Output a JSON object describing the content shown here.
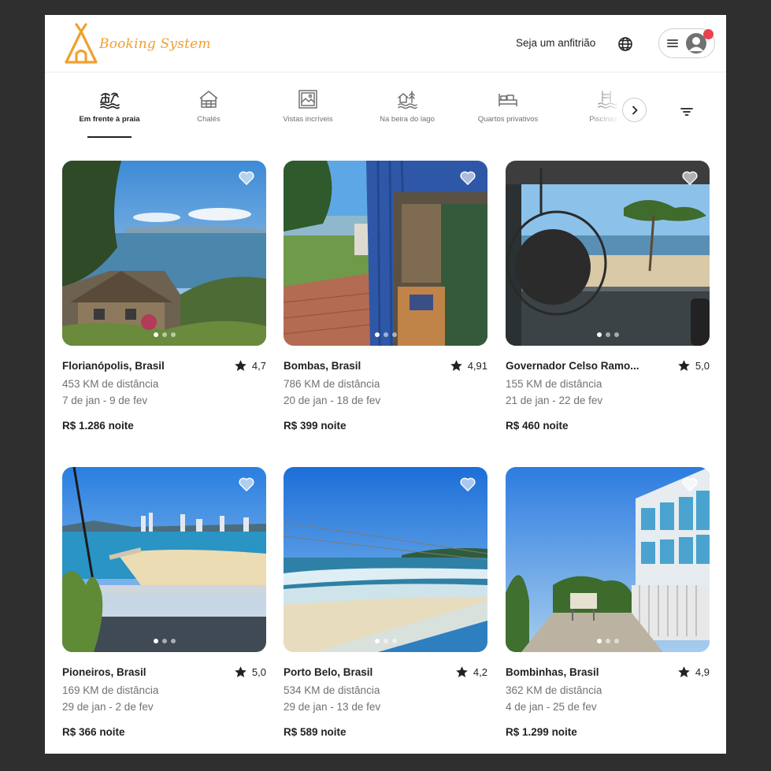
{
  "app": {
    "brand": "Booking System",
    "host_link": "Seja um anfitrião"
  },
  "icons": {
    "globe": "globe-icon",
    "menu": "hamburger-menu-icon",
    "avatar": "user-avatar-icon",
    "next": "chevron-right-icon",
    "filter": "filter-icon",
    "favorite": "heart-icon",
    "rating": "star-icon"
  },
  "colors": {
    "brand": "#f0a030",
    "notification": "#e8414f",
    "text": "#222222",
    "muted": "#717171"
  },
  "categories": [
    {
      "label": "Em frente à praia",
      "icon": "beachfront-icon",
      "active": true
    },
    {
      "label": "Chalés",
      "icon": "cabin-icon",
      "active": false
    },
    {
      "label": "Vistas incríveis",
      "icon": "amazing-views-icon",
      "active": false
    },
    {
      "label": "Na beira do lago",
      "icon": "lakefront-icon",
      "active": false
    },
    {
      "label": "Quartos privativos",
      "icon": "private-room-icon",
      "active": false
    },
    {
      "label": "Piscinas in",
      "icon": "pool-icon",
      "active": false
    }
  ],
  "listings": [
    {
      "location": "Florianópolis, Brasil",
      "rating": "4,7",
      "distance": "453 KM de distância",
      "dates": "7 de jan - 9 de fev",
      "price": "R$ 1.286",
      "price_unit": "noite"
    },
    {
      "location": "Bombas, Brasil",
      "rating": "4,91",
      "distance": "786 KM de distância",
      "dates": "20 de jan - 18 de fev",
      "price": "R$ 399",
      "price_unit": "noite"
    },
    {
      "location": "Governador Celso Ramo...",
      "rating": "5,0",
      "distance": "155 KM de distância",
      "dates": "21 de jan - 22 de fev",
      "price": "R$ 460",
      "price_unit": "noite"
    },
    {
      "location": "Pioneiros, Brasil",
      "rating": "5,0",
      "distance": "169 KM de distância",
      "dates": "29 de jan - 2 de fev",
      "price": "R$ 366",
      "price_unit": "noite"
    },
    {
      "location": "Porto Belo, Brasil",
      "rating": "4,2",
      "distance": "534 KM de distância",
      "dates": "29 de jan - 13 de fev",
      "price": "R$ 589",
      "price_unit": "noite"
    },
    {
      "location": "Bombinhas, Brasil",
      "rating": "4,9",
      "distance": "362 KM de distância",
      "dates": "4 de jan - 25 de fev",
      "price": "R$ 1.299",
      "price_unit": "noite"
    }
  ]
}
